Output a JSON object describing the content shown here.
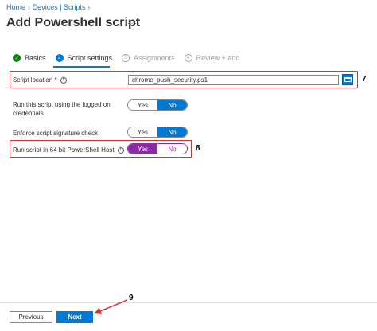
{
  "breadcrumb": {
    "home": "Home",
    "devices_scripts": "Devices | Scripts"
  },
  "page": {
    "title": "Add Powershell script",
    "more": "···"
  },
  "steps": [
    {
      "label": "Basics",
      "state": "done",
      "marker": "✓"
    },
    {
      "label": "Script settings",
      "state": "active",
      "marker": "2"
    },
    {
      "label": "Assignments",
      "state": "pending",
      "marker": "3"
    },
    {
      "label": "Review + add",
      "state": "pending",
      "marker": "4"
    }
  ],
  "script_location": {
    "label": "Script location *",
    "value": "chrome_push_security.ps1"
  },
  "logged_on": {
    "label_line1": "Run this script using the logged on",
    "label_line2": "credentials",
    "yes": "Yes",
    "no": "No",
    "selected": "No"
  },
  "signature": {
    "label": "Enforce script signature check",
    "yes": "Yes",
    "no": "No",
    "selected": "No"
  },
  "host64": {
    "label": "Run script in 64 bit PowerShell Host",
    "yes": "Yes",
    "no": "No",
    "selected": "Yes"
  },
  "annotations": {
    "a7": "7",
    "a8": "8",
    "a9": "9"
  },
  "footer": {
    "previous": "Previous",
    "next": "Next"
  },
  "colors": {
    "accent": "#0078d4",
    "success": "#107c10",
    "highlight": "#d13438",
    "toggle_on_purple": "#8a2da5"
  }
}
